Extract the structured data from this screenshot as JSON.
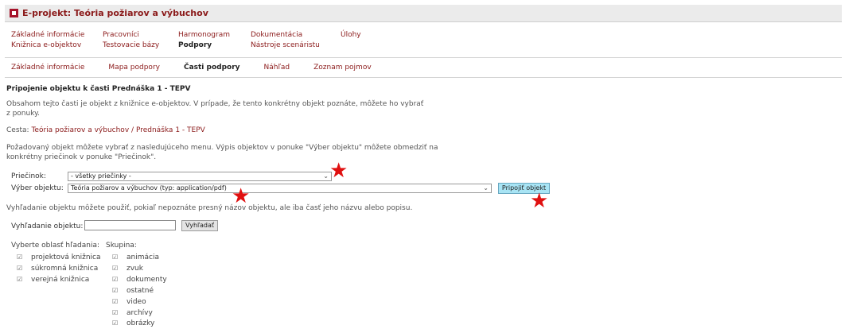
{
  "title": "E-projekt: Teória požiarov a výbuchov",
  "top_menu": {
    "col1": [
      "Základné informácie",
      "Knižnica e-objektov"
    ],
    "col2": [
      "Pracovníci",
      "Testovacie bázy"
    ],
    "col3": [
      "Harmonogram",
      "Podpory"
    ],
    "col4": [
      "Dokumentácia",
      "Nástroje scenáristu"
    ],
    "col5": [
      "Úlohy"
    ]
  },
  "sub_menu": [
    "Základné informácie",
    "Mapa podpory",
    "Časti podpory",
    "Náhľad",
    "Zoznam pojmov"
  ],
  "heading": "Pripojenie objektu k časti Prednáška 1 - TEPV",
  "intro_line1": "Obsahom tejto časti je objekt z knižnice e-objektov. V prípade, že tento konkrétny objekt poznáte, môžete ho vybrať",
  "intro_line2": "z ponuky.",
  "path_label": "Cesta:",
  "path_link1": "Teória požiarov a výbuchov",
  "path_sep": "/",
  "path_link2": "Prednáška 1 - TEPV",
  "select_info_line1": "Požadovaný objekt môžete vybrať z nasledujúceho menu. Výpis objektov v ponuke \"Výber objektu\" môžete obmedziť na",
  "select_info_line2": "konkrétny priečinok v ponuke \"Priečinok\".",
  "folder_label": "Priečinok:",
  "folder_value": "- všetky priečinky -",
  "object_label": "Výber objektu:",
  "object_value": "Teória požiarov a výbuchov (typ: application/pdf)",
  "attach_button": "Pripojiť objekt",
  "search_info": "Vyhľadanie objektu môžete použiť, pokiaľ nepoznáte presný názov objektu, ale iba časť jeho názvu alebo popisu.",
  "search_label": "Vyhľadanie objektu:",
  "search_value": "",
  "search_button": "Vyhľadať",
  "area_label": "Vyberte oblasť hľadania:",
  "areas": [
    "projektová knižnica",
    "súkromná knižnica",
    "verejná knižnica"
  ],
  "group_label": "Skupina:",
  "groups": [
    "animácia",
    "zvuk",
    "dokumenty",
    "ostatné",
    "video",
    "archívy",
    "obrázky"
  ],
  "check_glyph": "☑",
  "chevron_glyph": "⌄",
  "star_glyph": "★",
  "star_color": "#e01010",
  "accent_color": "#8b1a1a"
}
